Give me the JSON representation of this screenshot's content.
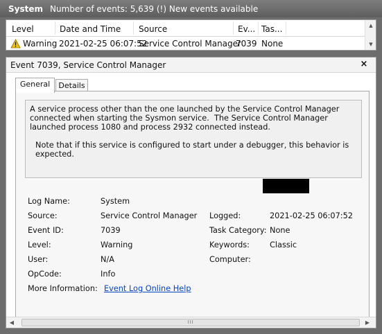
{
  "header": {
    "title": "System",
    "event_count": "Number of events: 5,639 (!) New events available"
  },
  "event_list": {
    "columns": [
      "Level",
      "Date and Time",
      "Source",
      "Ev...",
      "Tas..."
    ],
    "rows": [
      {
        "level": "Warning",
        "date_time": "2021-02-25 06:07:52",
        "source": "Service Control Manager",
        "event_id": "7039",
        "task": "None"
      }
    ]
  },
  "detail": {
    "title": "Event 7039, Service Control Manager",
    "tabs": [
      "General",
      "Details"
    ],
    "active_tab": "General",
    "description": {
      "line1": "A service process other than the one launched by the Service Control Manager connected when starting the Sysmon service.  The Service Control Manager launched process 1080 and process 2932 connected instead.",
      "note": "Note that if this service is configured to start under a debugger, this behavior is expected."
    },
    "fields": {
      "log_name_label": "Log Name:",
      "log_name": "System",
      "source_label": "Source:",
      "source": "Service Control Manager",
      "event_id_label": "Event ID:",
      "event_id": "7039",
      "level_label": "Level:",
      "level": "Warning",
      "user_label": "User:",
      "user": "N/A",
      "opcode_label": "OpCode:",
      "opcode": "Info",
      "more_info_label": "More Information:",
      "more_info_link": "Event Log Online Help",
      "logged_label": "Logged:",
      "logged": "2021-02-25 06:07:52",
      "task_category_label": "Task Category:",
      "task_category": "None",
      "keywords_label": "Keywords:",
      "keywords": "Classic",
      "computer_label": "Computer:"
    }
  },
  "colors": {
    "header_bg": "#6d6d6d",
    "warning_icon": "#f2c500",
    "link": "#0645c8",
    "redaction": "#000000"
  },
  "icons": {
    "warning": "warning-icon",
    "close": "close-icon",
    "scroll_up": "scroll-up-icon",
    "scroll_down": "scroll-down-icon",
    "scroll_left": "scroll-left-icon",
    "scroll_right": "scroll-right-icon"
  }
}
